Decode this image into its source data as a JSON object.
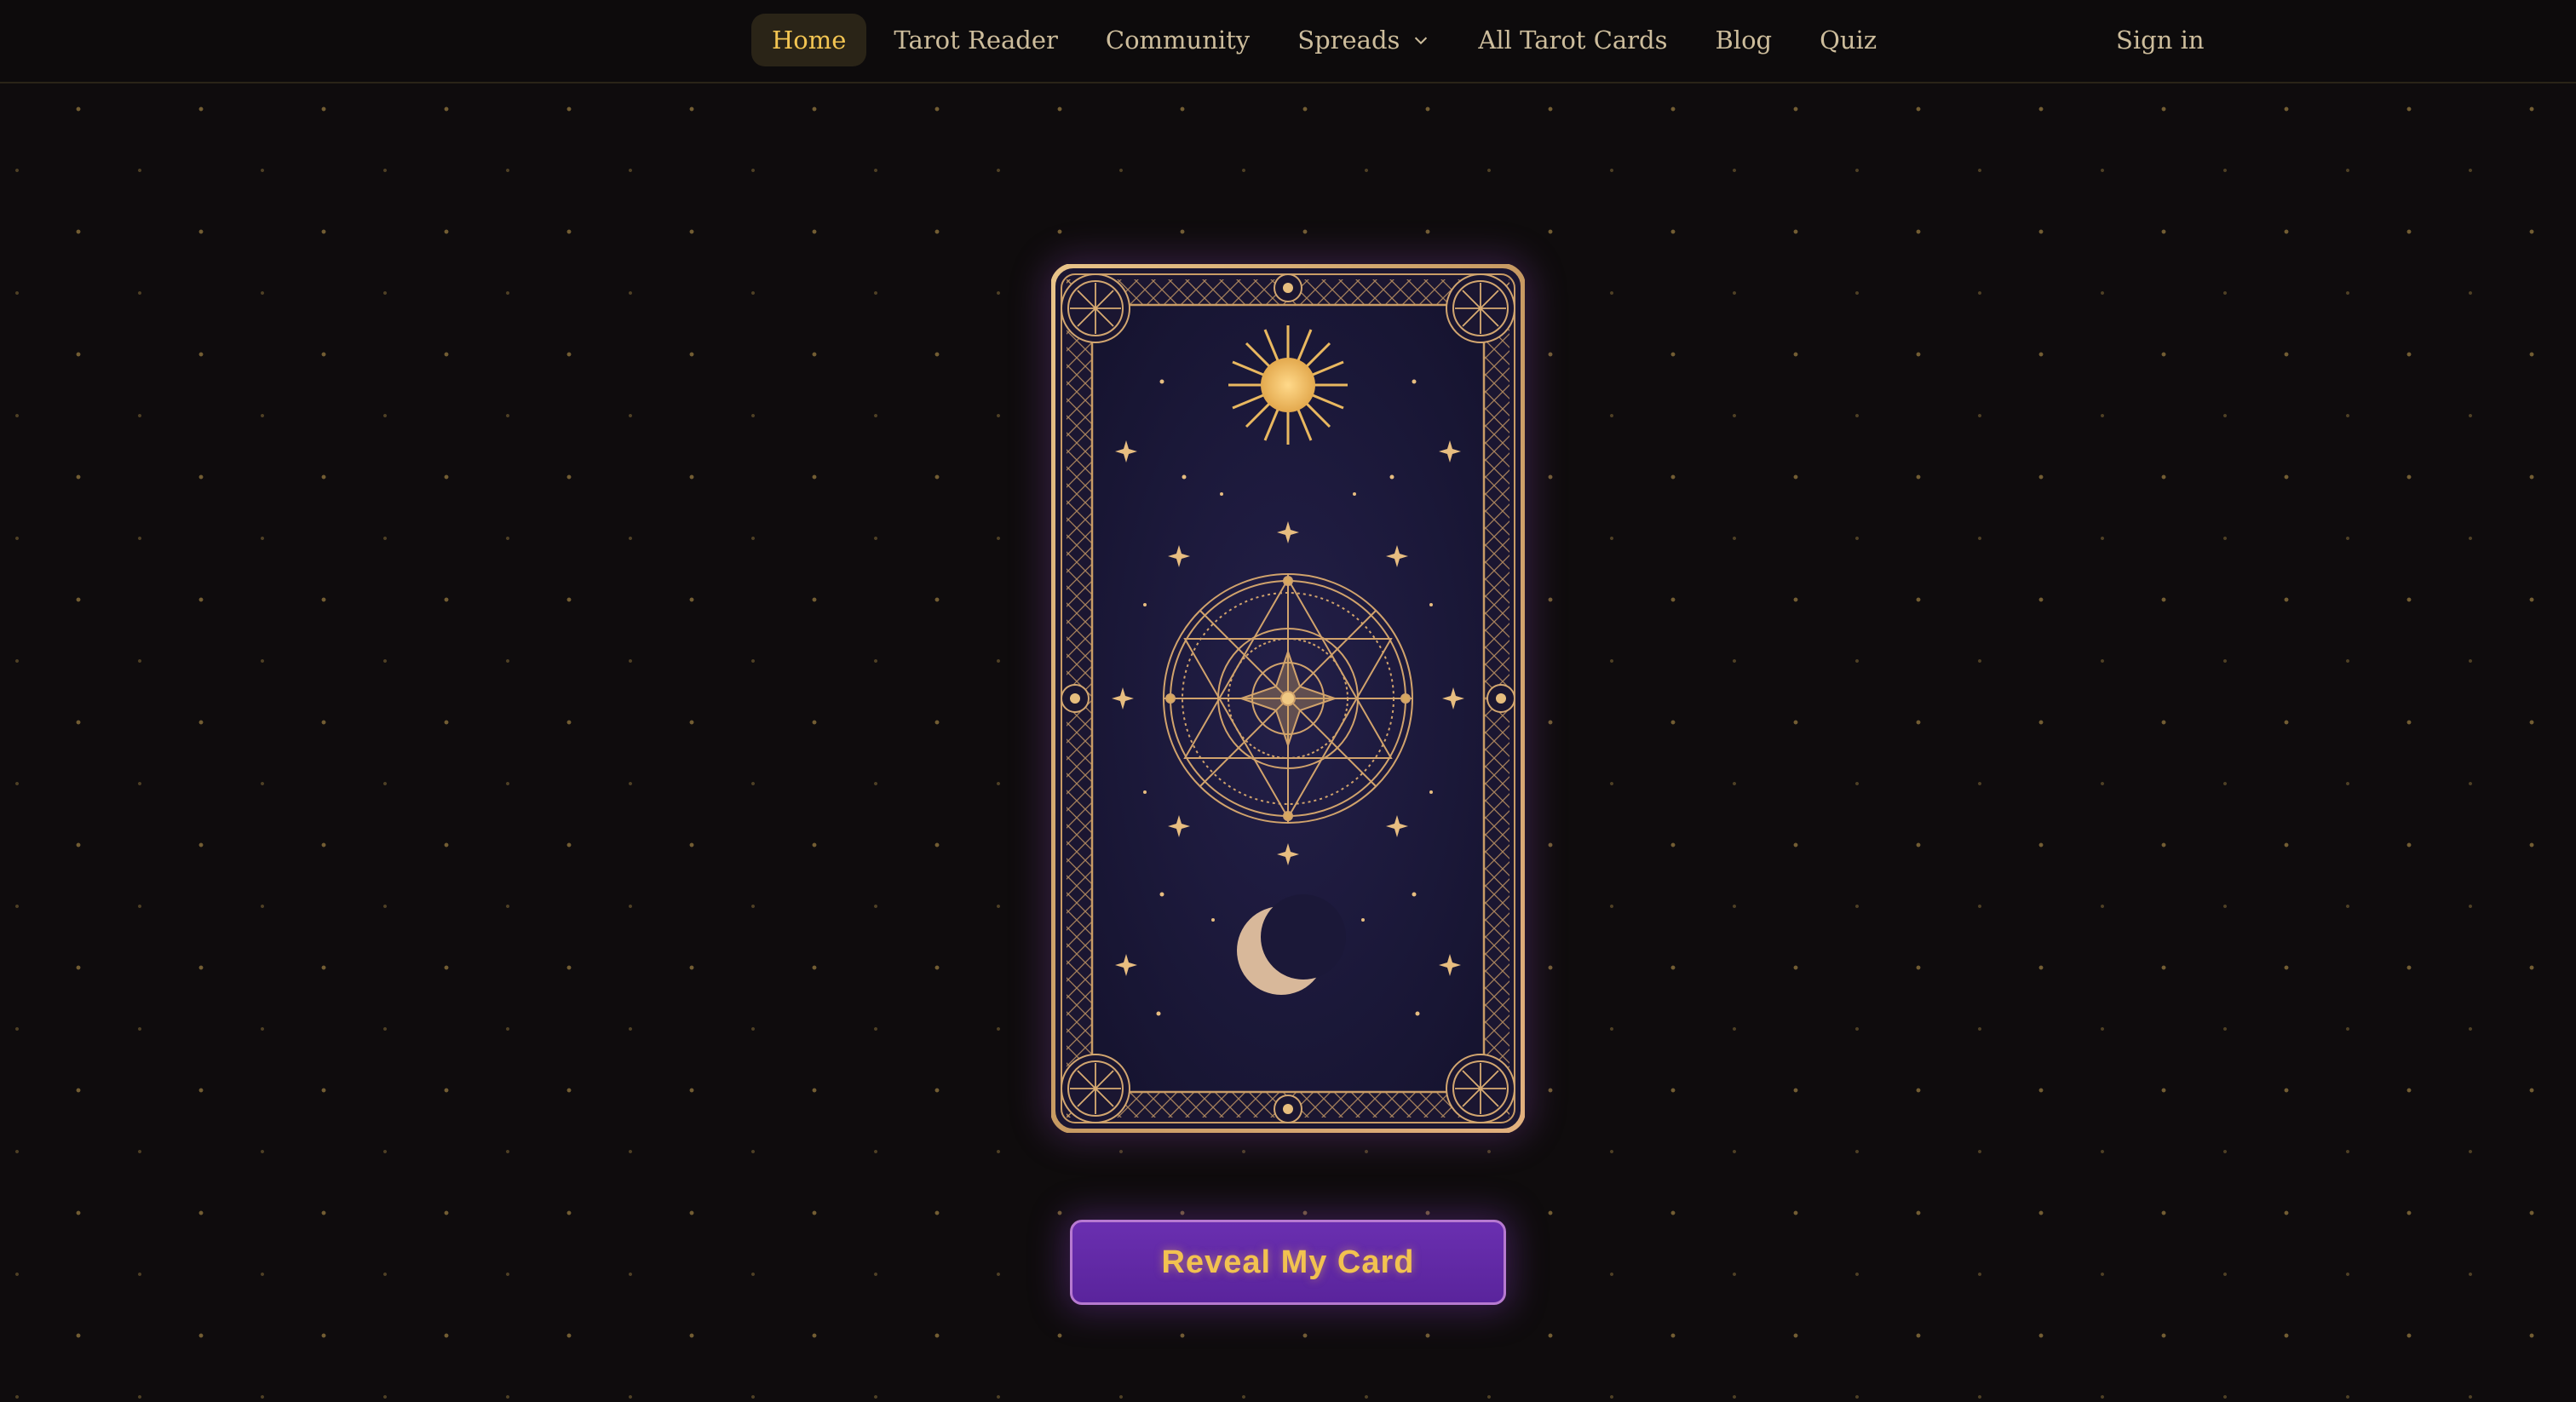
{
  "nav": {
    "items": [
      {
        "label": "Home",
        "active": true
      },
      {
        "label": "Tarot Reader"
      },
      {
        "label": "Community"
      },
      {
        "label": "Spreads",
        "has_dropdown": true
      },
      {
        "label": "All Tarot Cards"
      },
      {
        "label": "Blog"
      },
      {
        "label": "Quiz"
      }
    ],
    "sign_in_label": "Sign in"
  },
  "card": {
    "icons": [
      "sun-icon",
      "compass-star-icon",
      "crescent-moon-icon"
    ]
  },
  "reveal_button_label": "Reveal My Card",
  "colors": {
    "background": "#0f0c0d",
    "gold": "#d8a860",
    "accent_active": "#f3c552",
    "card_bg": "#1a1838",
    "button_bg": "#6a2fb0",
    "button_text": "#f2c250"
  }
}
